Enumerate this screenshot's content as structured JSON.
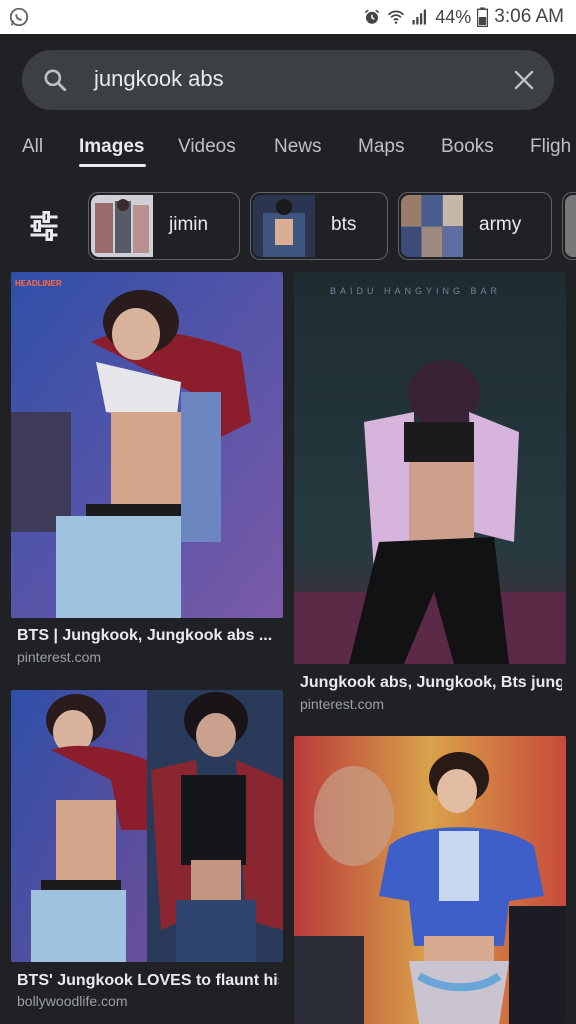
{
  "status_bar": {
    "battery": "44%",
    "time": "3:06 AM",
    "icons": [
      "whatsapp-icon",
      "alarm-icon",
      "wifi-icon",
      "signal-icon",
      "battery-icon"
    ]
  },
  "search": {
    "query": "jungkook abs"
  },
  "tabs": [
    {
      "label": "All"
    },
    {
      "label": "Images"
    },
    {
      "label": "Videos"
    },
    {
      "label": "News"
    },
    {
      "label": "Maps"
    },
    {
      "label": "Books"
    },
    {
      "label": "Fligh"
    }
  ],
  "chips": [
    {
      "label": "jimin"
    },
    {
      "label": "bts"
    },
    {
      "label": "army"
    }
  ],
  "results": [
    {
      "title": "BTS | Jungkook, Jungkook abs ...",
      "source": "pinterest.com",
      "badge": "HEADLINER"
    },
    {
      "title": "Jungkook abs, Jungkook, Bts jung...",
      "source": "pinterest.com",
      "watermark": "BAIDU HANGYING BAR"
    },
    {
      "title": "BTS' Jungkook LOVES to flaunt his...",
      "source": "bollywoodlife.com"
    },
    {
      "title": "",
      "source": ""
    }
  ],
  "colors": {
    "background": "#202124",
    "search_bar": "#3c4043",
    "chip_border": "#5f6368",
    "text_primary": "#e8eaed",
    "text_secondary": "#9aa0a6"
  }
}
